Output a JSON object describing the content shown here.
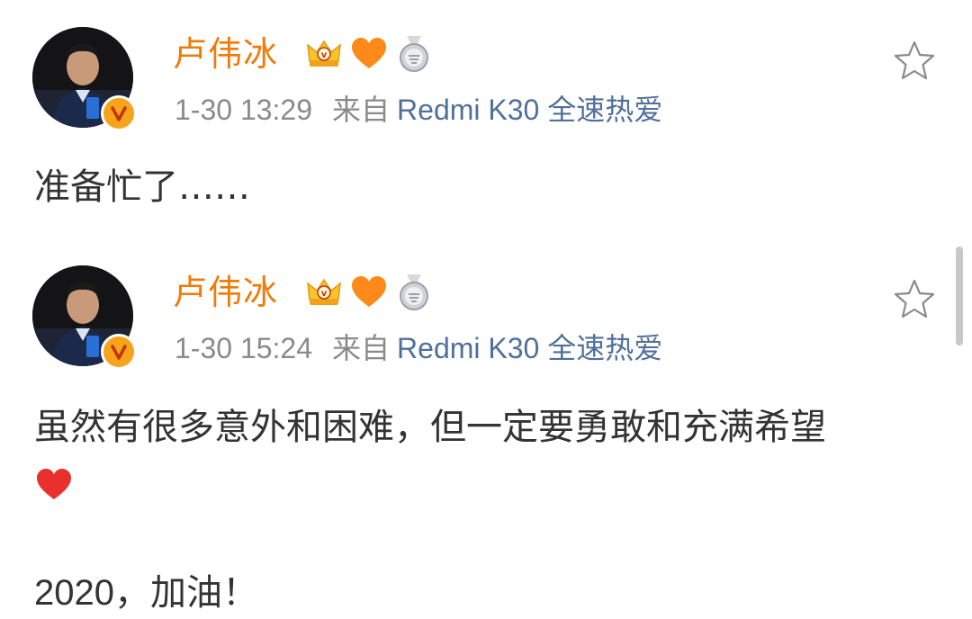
{
  "posts": [
    {
      "username": "卢伟冰",
      "time": "1-30 13:29",
      "source_prefix": "来自",
      "device": "Redmi K30 全速热爱",
      "text_lines": [
        "准备忙了……"
      ],
      "badges": [
        "crown-icon",
        "orange-heart-icon",
        "medal-icon"
      ],
      "favorite_icon": "star-outline-icon",
      "verified_icon": "verified-v-icon"
    },
    {
      "username": "卢伟冰",
      "time": "1-30 15:24",
      "source_prefix": "来自",
      "device": "Redmi K30 全速热爱",
      "text_lines": [
        "虽然有很多意外和困难，但一定要勇敢和充满希望",
        "2020，加油！"
      ],
      "inline_emoji": "red-heart-icon",
      "badges": [
        "crown-icon",
        "orange-heart-icon",
        "medal-icon"
      ],
      "favorite_icon": "star-outline-icon",
      "verified_icon": "verified-v-icon"
    }
  ],
  "colors": {
    "username": "#f07b06",
    "meta": "#8a8a8a",
    "link": "#50709a",
    "text": "#333333",
    "verified": "#f7a41c",
    "heart_red": "#e8302c",
    "heart_orange": "#ff8a1a"
  }
}
